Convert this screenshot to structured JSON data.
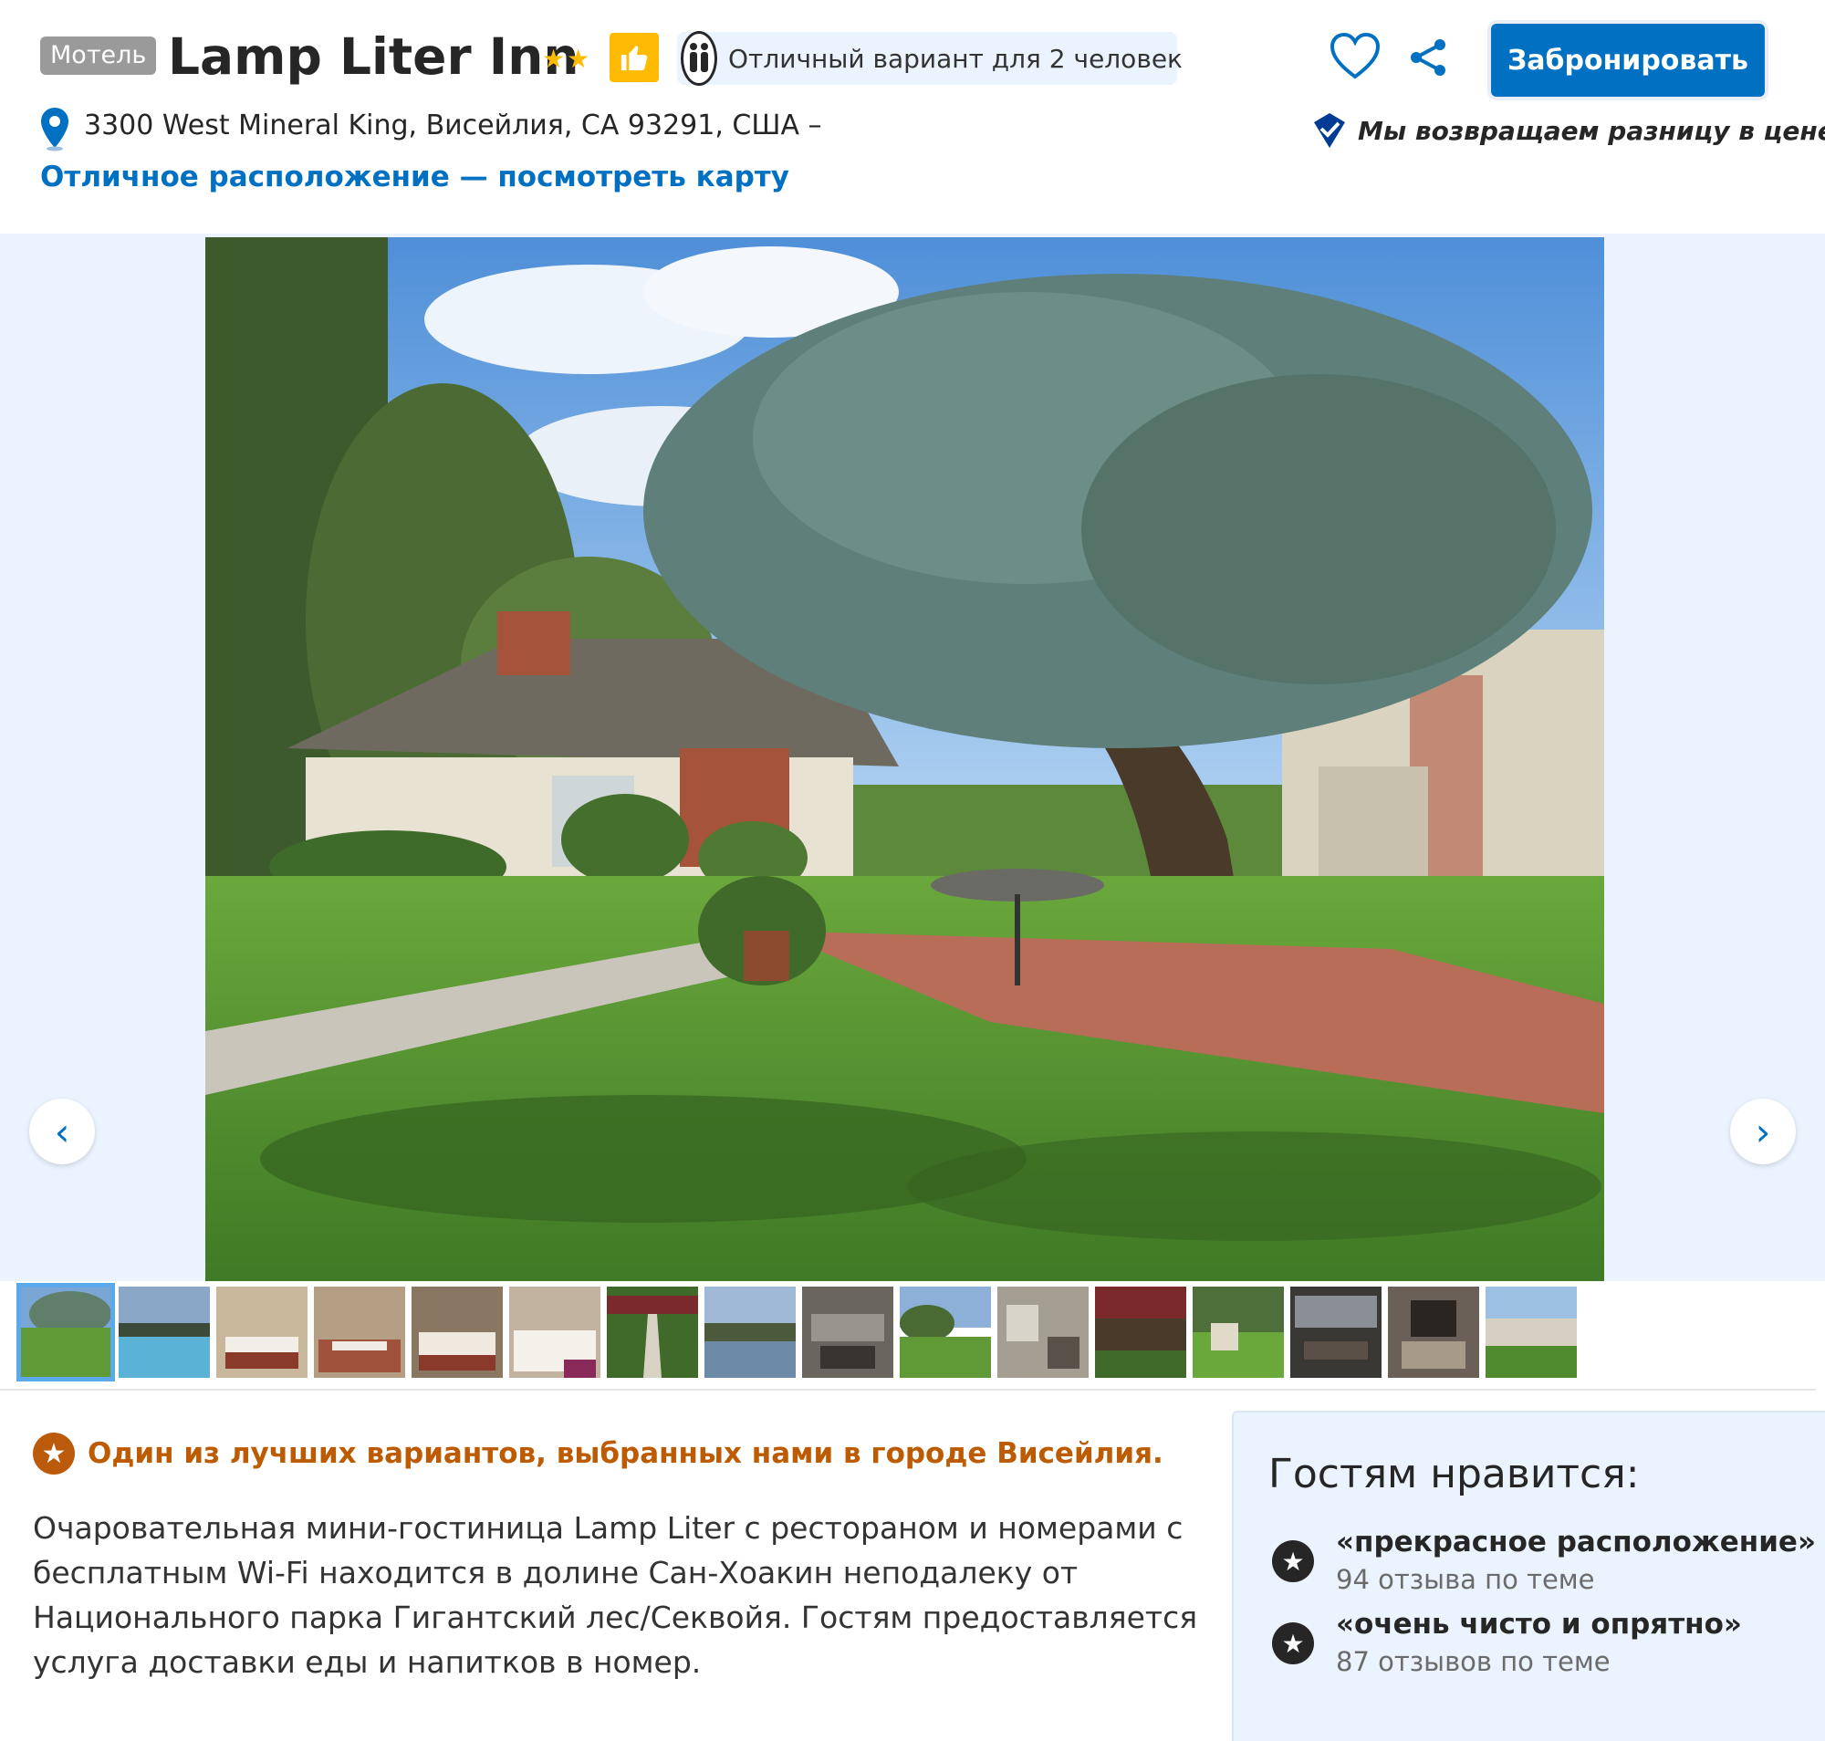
{
  "header": {
    "property_type": "Мотель",
    "hotel_name": "Lamp Liter Inn",
    "star_rating": 2,
    "thumb_icon": "thumbs-up-icon",
    "fit_text": "Отличный вариант для 2 человек",
    "book_label": "Забронировать",
    "address": "3300 West Mineral King, Висейлия, CA 93291, США –",
    "map_link": "Отличное расположение — посмотреть карту",
    "price_match": "Мы возвращаем разницу в цене"
  },
  "gallery": {
    "prev_arrow": "‹",
    "next_arrow": "›",
    "thumbnail_count": 16,
    "active_thumbnail": 1
  },
  "description": {
    "pick": "Один из лучших вариантов, выбранных нами в городе Висейлия.",
    "text": "Очаровательная мини-гостиница Lamp Liter с рестораном и номерами с бесплатным Wi-Fi находится в долине Сан-Хоакин неподалеку от Национального парка Гигантский лес/Секвойя. Гостям предоставляется услуга доставки еды и напитков в номер."
  },
  "guests_like": {
    "title": "Гостям нравится:",
    "items": [
      {
        "quote": "«прекрасное расположение»",
        "count": "94 отзыва по теме"
      },
      {
        "quote": "«очень чисто и опрятно»",
        "count": "87 отзывов по теме"
      }
    ]
  },
  "colors": {
    "brand_blue": "#0071c2",
    "star_yellow": "#febb02",
    "pick_orange": "#bc5b01",
    "panel_bg": "#ebf3ff"
  }
}
